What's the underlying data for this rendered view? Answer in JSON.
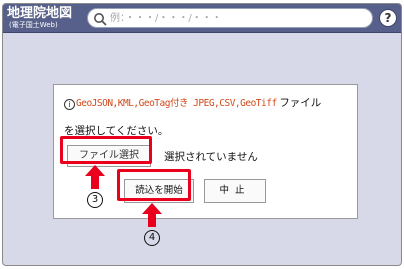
{
  "app": {
    "logo_main": "地理院地図",
    "logo_sub": "(電子国土Web)"
  },
  "search": {
    "placeholder": "例：・・・/・・・/・・・"
  },
  "help": {
    "label": "?"
  },
  "dialog": {
    "info_icon": "i",
    "info_types": "GeoJSON,KML,GeoTag付き JPEG,CSV,GeoTiff",
    "info_suffix": " ファイル",
    "info_line2": "を選択してください。",
    "file_select_label": "ファイル選択",
    "file_status": "選択されていません",
    "load_label": "読込を開始",
    "cancel_label": "中止"
  },
  "annotations": {
    "step3": "3",
    "step4": "4",
    "highlight_color": "#e8001c"
  },
  "colors": {
    "header": "#57608a",
    "background": "#d7d9e8",
    "info_accent": "#d24a1b"
  }
}
